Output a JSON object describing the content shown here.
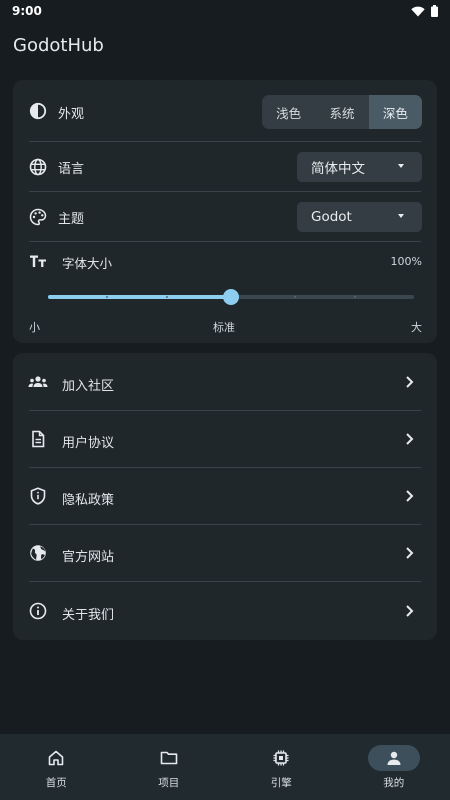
{
  "status": {
    "time": "9:00"
  },
  "app": {
    "title": "GodotHub"
  },
  "appearance": {
    "label": "外观",
    "options": [
      "浅色",
      "系统",
      "深色"
    ],
    "selected": "深色"
  },
  "language": {
    "label": "语言",
    "value": "简体中文"
  },
  "theme": {
    "label": "主题",
    "value": "Godot"
  },
  "font_size": {
    "label": "字体大小",
    "value_text": "100%",
    "level": 0.5,
    "min_label": "小",
    "mid_label": "标准",
    "max_label": "大"
  },
  "links": [
    {
      "label": "加入社区",
      "icon": "groups-icon"
    },
    {
      "label": "用户协议",
      "icon": "document-icon"
    },
    {
      "label": "隐私政策",
      "icon": "shield-icon"
    },
    {
      "label": "官方网站",
      "icon": "globe-icon"
    },
    {
      "label": "关于我们",
      "icon": "info-icon"
    }
  ],
  "nav": [
    {
      "label": "首页",
      "icon": "home-icon"
    },
    {
      "label": "项目",
      "icon": "folder-icon"
    },
    {
      "label": "引擎",
      "icon": "chip-icon"
    },
    {
      "label": "我的",
      "icon": "person-icon",
      "active": true
    }
  ],
  "colors": {
    "accent": "#8ccdf0",
    "background": "#171c20",
    "card": "#20272b"
  }
}
